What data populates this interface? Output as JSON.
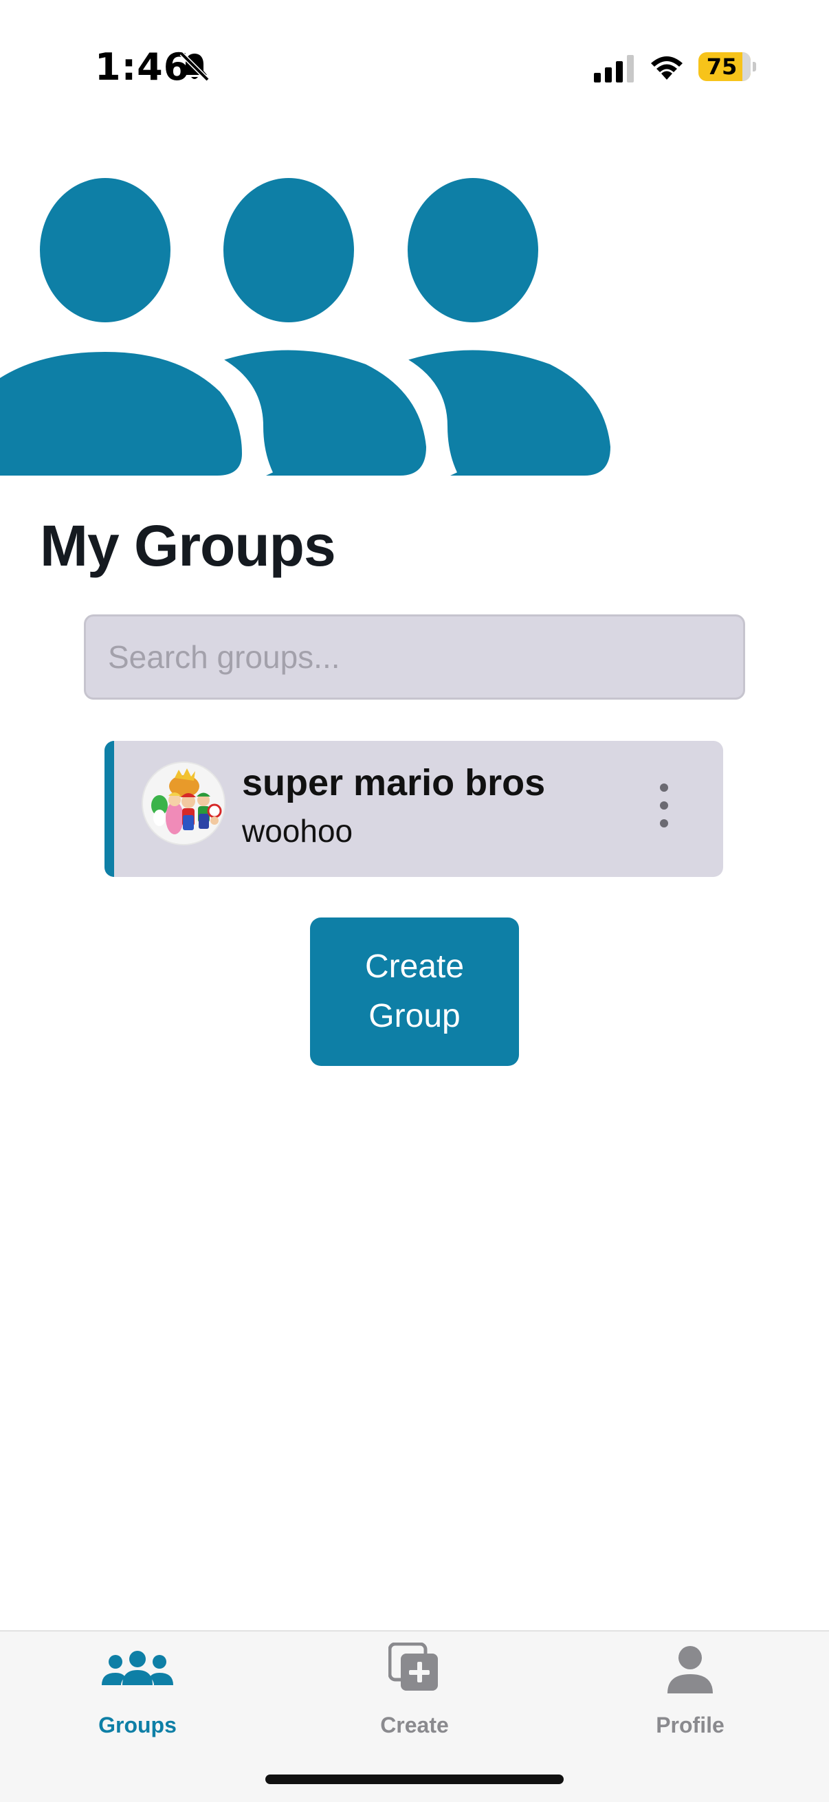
{
  "status_bar": {
    "time": "1:46",
    "battery": "75",
    "icons": [
      "bell-slash-icon",
      "cellular-signal-icon",
      "wifi-icon",
      "battery-icon"
    ]
  },
  "hero": {
    "icon": "users-group-icon",
    "color": "#0e7fa6"
  },
  "main": {
    "title": "My Groups",
    "search": {
      "placeholder": "Search groups...",
      "value": ""
    },
    "groups": [
      {
        "name": "super mario bros",
        "description": "woohoo",
        "avatar_icon": "group-avatar-image",
        "menu_icon": "more-vertical-icon"
      }
    ],
    "create_button_label": "Create Group"
  },
  "tab_bar": {
    "tabs": [
      {
        "label": "Groups",
        "icon": "users-icon",
        "active": true
      },
      {
        "label": "Create",
        "icon": "add-square-icon",
        "active": false
      },
      {
        "label": "Profile",
        "icon": "person-icon",
        "active": false
      }
    ]
  },
  "colors": {
    "accent": "#0e7fa6",
    "card_bg": "#d9d7e2",
    "battery": "#f7c31a",
    "inactive_tab": "#8a8a8e"
  }
}
